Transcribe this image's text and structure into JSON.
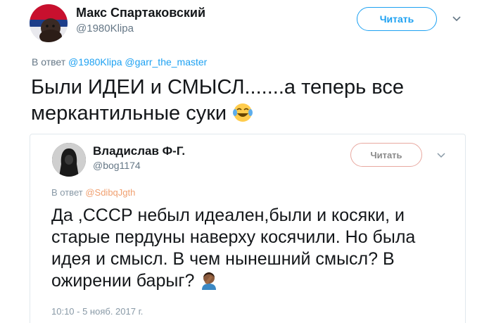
{
  "tweet": {
    "author_name": "Макс Спартаковский",
    "author_handle": "@1980Klipa",
    "follow_label": "Читать",
    "reply_prefix": "В ответ",
    "reply_handles": "@1980Klipa @garr_the_master",
    "text": "Были ИДЕИ и СМЫСЛ.......а теперь все меркантильные суки",
    "emoji": "face-with-tears-of-joy"
  },
  "quoted_tweet": {
    "author_name": "Владислав Ф-Г.",
    "author_handle": "@bog1174",
    "follow_label": "Читать",
    "reply_prefix": "В ответ",
    "reply_handle": "@SdibqJgth",
    "text": "Да ,СССР небыл идеален,были и косяки, и старые пердуны наверху косячили. Но была идея и смысл. В чем нынешний смысл? В ожирении барыг?",
    "emoji": "person-facepalming",
    "timestamp": "10:10 - 5 нояб. 2017 г."
  },
  "colors": {
    "accent": "#1da1f2",
    "muted": "#657786",
    "text": "#14171a",
    "border": "#e1e8ed"
  }
}
